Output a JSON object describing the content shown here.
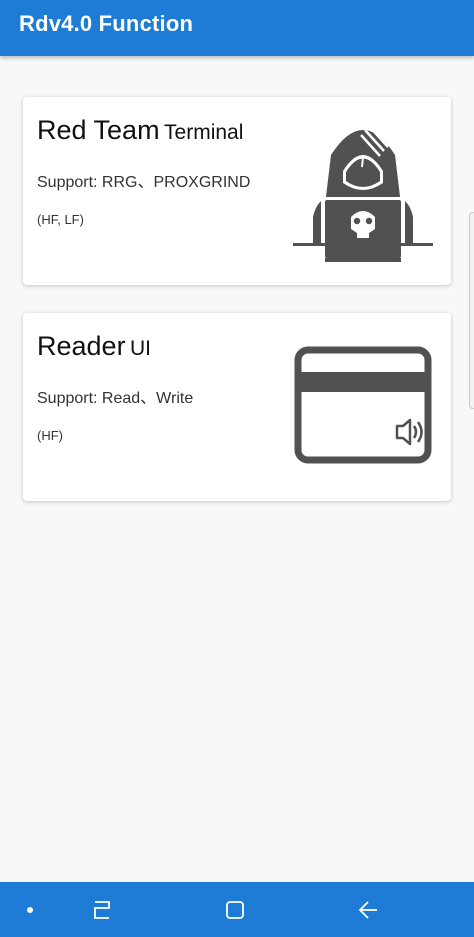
{
  "app_bar": {
    "title": "Rdv4.0 Function"
  },
  "cards": [
    {
      "title_main": "Red Team",
      "title_sub": "Terminal",
      "support": "Support: RRG、PROXGRIND",
      "bands": "(HF, LF)",
      "icon": "hacker-icon"
    },
    {
      "title_main": "Reader",
      "title_sub": "UI",
      "support": "Support: Read、Write",
      "bands": "(HF)",
      "icon": "card-reader-icon"
    }
  ],
  "navigation_bar": {
    "buttons": [
      "dot-icon",
      "recent-apps-icon",
      "home-icon",
      "back-icon"
    ],
    "color": "#1e7bd6"
  },
  "colors": {
    "accent": "#1e7bd6",
    "icon_gray": "#515151"
  }
}
